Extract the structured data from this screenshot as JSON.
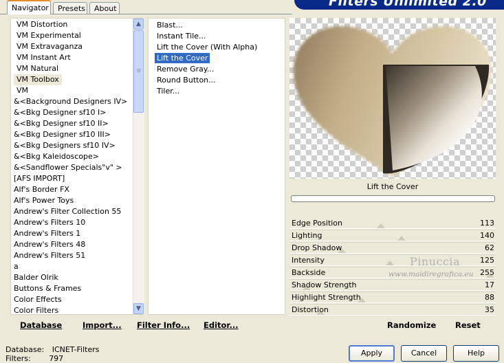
{
  "tabs": [
    "Navigator",
    "Presets",
    "About"
  ],
  "banner_title": "Filters Unlimited 2.0",
  "categories": [
    "VM Distortion",
    "VM Experimental",
    "VM Extravaganza",
    "VM Instant Art",
    "VM Natural",
    "VM Toolbox",
    "VM",
    "&<Background Designers IV>",
    "&<Bkg Designer sf10 I>",
    "&<Bkg Designer sf10 II>",
    "&<Bkg Designer sf10 III>",
    "&<Bkg Designers sf10 IV>",
    "&<Bkg Kaleidoscope>",
    "&<Sandflower Specials\"v\" >",
    "[AFS IMPORT]",
    "Alf's Border FX",
    "Alf's Power Toys",
    "Andrew's Filter Collection 55",
    "Andrew's Filters 10",
    "Andrew's Filters 1",
    "Andrew's Filters 48",
    "Andrew's Filters 51",
    "a",
    "Balder Olrik",
    "Buttons & Frames",
    "Color Effects",
    "Color Filters"
  ],
  "selected_category": "VM Toolbox",
  "filters": [
    "Blast...",
    "Instant Tile...",
    "Lift the Cover (With Alpha)",
    "Lift the Cover",
    "Remove Gray...",
    "Round Button...",
    "Tiler..."
  ],
  "selected_filter": "Lift the Cover",
  "preview_label": "Lift the Cover",
  "params": [
    {
      "name": "Edge Position",
      "value": "113"
    },
    {
      "name": "Lighting",
      "value": "140"
    },
    {
      "name": "Drop Shadow",
      "value": "62"
    },
    {
      "name": "Intensity",
      "value": "125"
    },
    {
      "name": "Backside",
      "value": "255"
    },
    {
      "name": "Shadow Strength",
      "value": "17"
    },
    {
      "name": "Highlight Strength",
      "value": "88"
    },
    {
      "name": "Distortion",
      "value": "35"
    }
  ],
  "left_buttons": {
    "database": "Database",
    "import": "Import...",
    "filter_info": "Filter Info...",
    "editor": "Editor..."
  },
  "right_buttons": {
    "randomize": "Randomize",
    "reset": "Reset"
  },
  "watermark": {
    "line1": "Pinuccia",
    "line2": "www.maidiregrafica.eu"
  },
  "footer": {
    "database_label": "Database:",
    "database_value": "ICNET-Filters",
    "filters_label": "Filters:",
    "filters_value": "797"
  },
  "dialog_buttons": {
    "apply": "Apply",
    "cancel": "Cancel",
    "help": "Help"
  }
}
